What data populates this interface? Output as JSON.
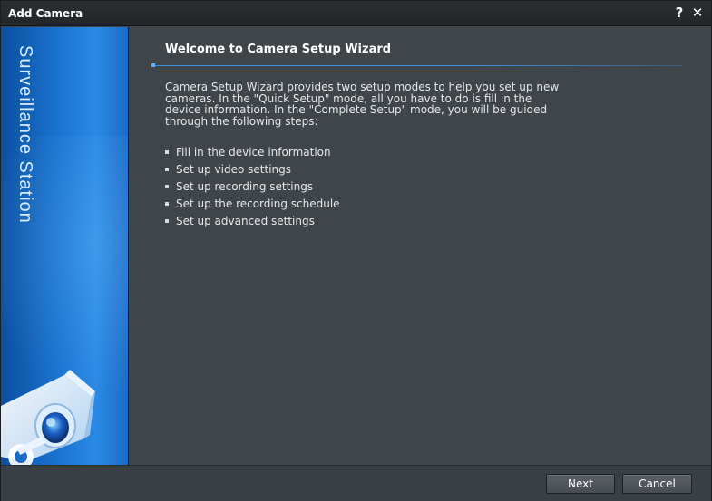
{
  "window": {
    "title": "Add Camera",
    "help_glyph": "?",
    "close_glyph": "✕"
  },
  "sidebar": {
    "brand": "Surveillance Station",
    "illustration": "security-camera-icon"
  },
  "main": {
    "heading": "Welcome to Camera Setup Wizard",
    "intro": "Camera Setup Wizard provides two setup modes to help you set up new cameras. In the \"Quick Setup\" mode, all you have to do is fill in the device information. In the \"Complete Setup\" mode, you will be guided through the following steps:",
    "steps": [
      "Fill in the device information",
      "Set up video settings",
      "Set up recording settings",
      "Set up the recording schedule",
      "Set up advanced settings"
    ]
  },
  "footer": {
    "next_label": "Next",
    "cancel_label": "Cancel"
  },
  "colors": {
    "accent": "#3d8fe0",
    "panel": "#3f4549",
    "sidebar": "#1a73d0"
  }
}
